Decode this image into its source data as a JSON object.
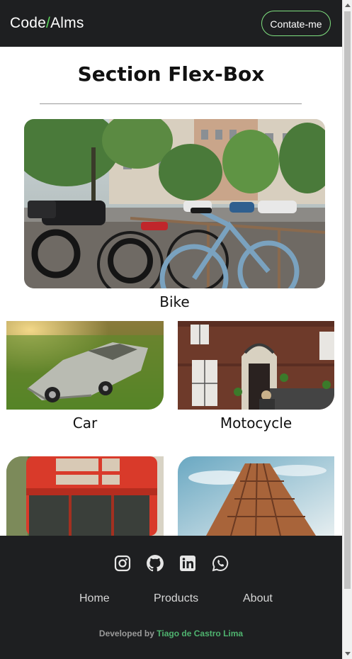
{
  "header": {
    "brand_part1": "Code",
    "brand_slash": "/",
    "brand_part2": "Alms",
    "contact_label": "Contate-me"
  },
  "section": {
    "title": "Section Flex-Box"
  },
  "cards": [
    {
      "label": "Bike",
      "image": "bicycles-parked-on-city-street"
    },
    {
      "label": "Car",
      "image": "vintage-silver-car-on-grass"
    },
    {
      "label": "Motocycle",
      "image": "brick-building-entrance"
    },
    {
      "label": "",
      "image": "red-double-decker-bus"
    },
    {
      "label": "",
      "image": "tall-skyscraper-against-sky"
    }
  ],
  "footer": {
    "social_icons": [
      "instagram-icon",
      "github-icon",
      "linkedin-icon",
      "whatsapp-icon"
    ],
    "nav": [
      "Home",
      "Products",
      "About"
    ],
    "credit_prefix": "Developed by",
    "credit_author": "Tiago de Castro Lima"
  },
  "colors": {
    "header_bg": "#1e1f21",
    "accent_green": "#5cd65c",
    "author_green": "#4fb36f"
  }
}
